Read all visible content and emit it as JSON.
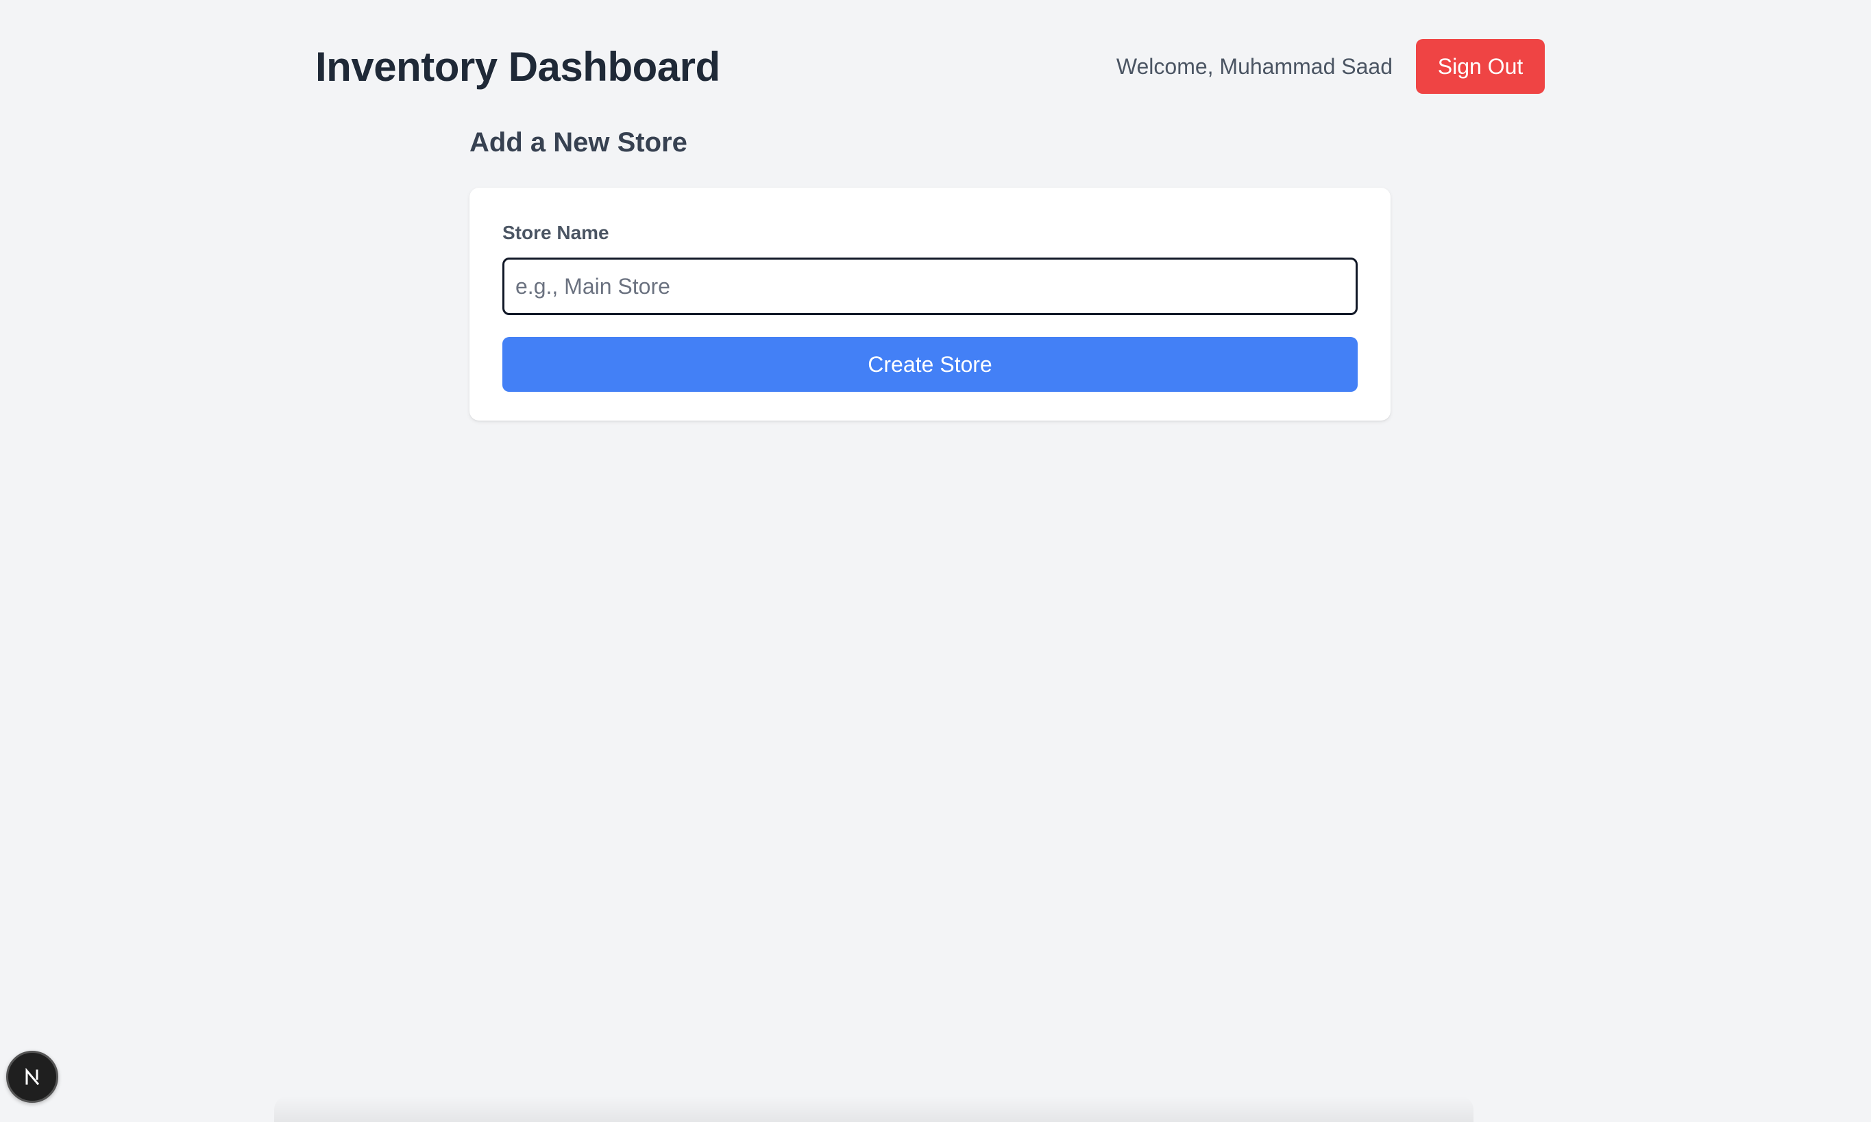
{
  "header": {
    "title": "Inventory Dashboard",
    "welcome_text": "Welcome, Muhammad Saad",
    "sign_out_label": "Sign Out"
  },
  "add_store": {
    "section_title": "Add a New Store",
    "field_label": "Store Name",
    "input_value": "",
    "input_placeholder": "e.g., Main Store",
    "submit_label": "Create Store"
  },
  "icons": {
    "dev_badge_icon": "nextjs-logo-icon"
  },
  "colors": {
    "background": "#f3f4f6",
    "title_text": "#1f2937",
    "sign_out_bg": "#ef4444",
    "primary_button_bg": "#4380f6",
    "card_bg": "#ffffff",
    "dev_badge_bg": "#1f1f1f"
  }
}
